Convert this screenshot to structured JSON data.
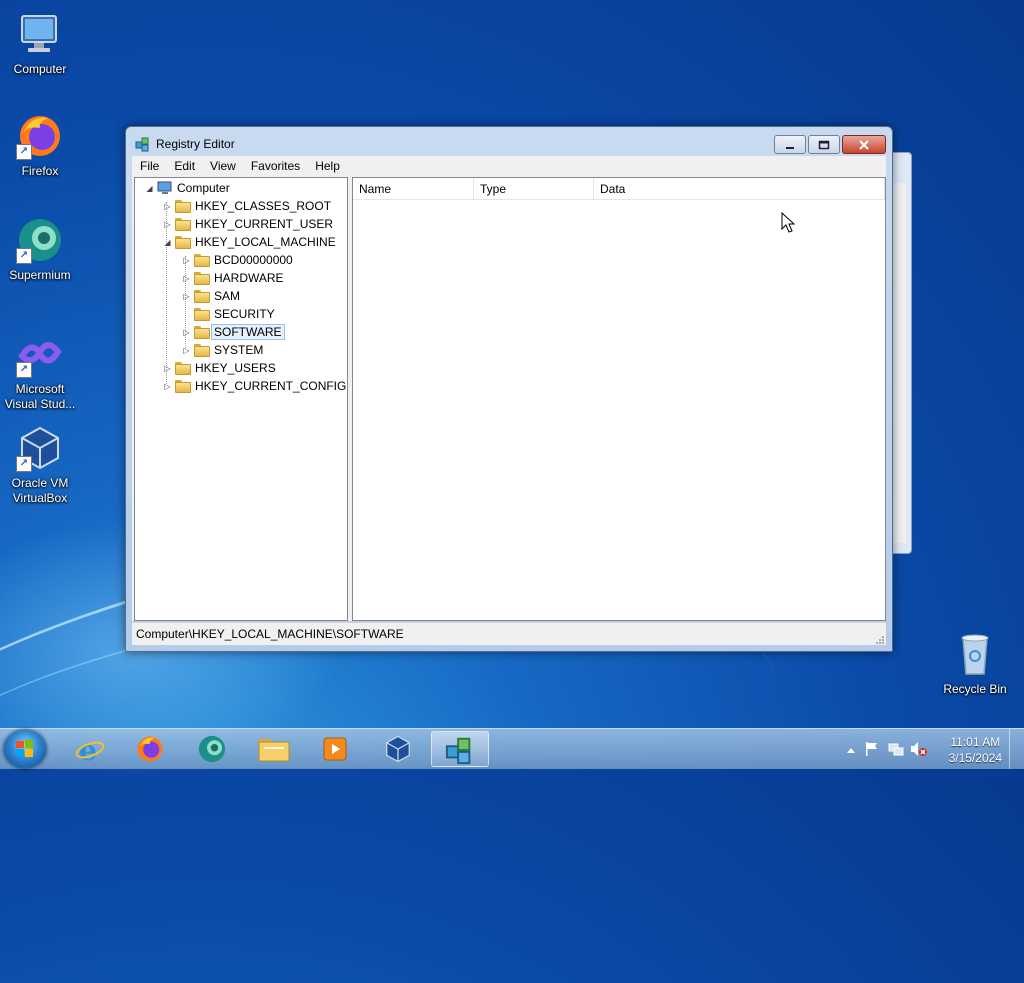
{
  "desktop": {
    "icons": [
      {
        "label": "Computer"
      },
      {
        "label": "Firefox"
      },
      {
        "label": "Supermium"
      },
      {
        "label": "Microsoft Visual Stud..."
      },
      {
        "label": "Oracle VM VirtualBox"
      },
      {
        "label": "Recycle Bin"
      }
    ]
  },
  "window": {
    "title": "Registry Editor",
    "menu": [
      "File",
      "Edit",
      "View",
      "Favorites",
      "Help"
    ],
    "tree": {
      "root": "Computer",
      "hives": [
        "HKEY_CLASSES_ROOT",
        "HKEY_CURRENT_USER",
        "HKEY_LOCAL_MACHINE",
        "HKEY_USERS",
        "HKEY_CURRENT_CONFIG"
      ],
      "hklm_children": [
        "BCD00000000",
        "HARDWARE",
        "SAM",
        "SECURITY",
        "SOFTWARE",
        "SYSTEM"
      ],
      "selected": "SOFTWARE"
    },
    "columns": [
      "Name",
      "Type",
      "Data"
    ],
    "status": "Computer\\HKEY_LOCAL_MACHINE\\SOFTWARE"
  },
  "taskbar": {
    "apps": [
      "internet-explorer",
      "firefox",
      "supermium",
      "file-explorer",
      "media-player",
      "virtualbox",
      "registry-editor"
    ],
    "active_app": "registry-editor",
    "time": "11:01 AM",
    "date": "3/15/2024"
  },
  "colors": {
    "selection_bg": "#e5f1fb",
    "selection_border": "#99c2ea",
    "close_button": "#c7452f"
  }
}
